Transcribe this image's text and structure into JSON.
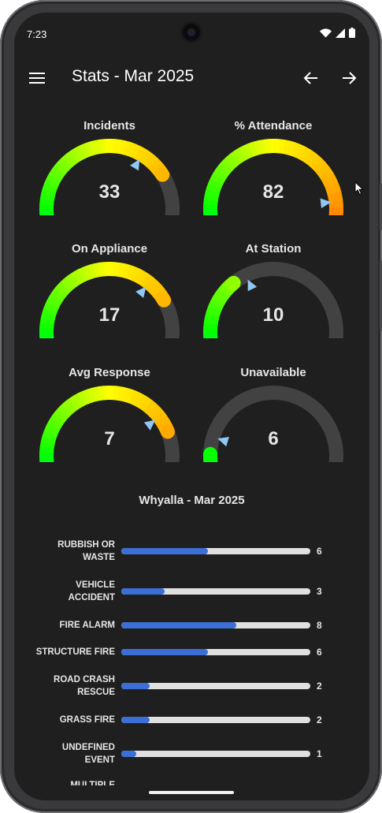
{
  "status": {
    "time": "7:23"
  },
  "header": {
    "title": "Stats - Mar 2025"
  },
  "gauges": [
    {
      "label": "Incidents",
      "value": "33",
      "level": 0.72,
      "marker": 0.62
    },
    {
      "label": "% Attendance",
      "value": "82",
      "level": 0.89,
      "marker": 0.82
    },
    {
      "label": "On Appliance",
      "value": "17",
      "level": 0.73,
      "marker": 0.65
    },
    {
      "label": "At Station",
      "value": "10",
      "level": 0.35,
      "marker": 0.4
    },
    {
      "label": "Avg Response",
      "value": "7",
      "level": 0.76,
      "marker": 0.7
    },
    {
      "label": "Unavailable",
      "value": "6",
      "level": 0.16,
      "marker": 0.22
    }
  ],
  "section": {
    "title": "Whyalla - Mar 2025"
  },
  "bars": [
    {
      "label": "RUBBISH OR WASTE",
      "value": "6",
      "fraction": 0.46
    },
    {
      "label": "VEHICLE ACCIDENT",
      "value": "3",
      "fraction": 0.23
    },
    {
      "label": "FIRE ALARM",
      "value": "8",
      "fraction": 0.61
    },
    {
      "label": "STRUCTURE FIRE",
      "value": "6",
      "fraction": 0.46
    },
    {
      "label": "ROAD CRASH RESCUE",
      "value": "2",
      "fraction": 0.15
    },
    {
      "label": "GRASS FIRE",
      "value": "2",
      "fraction": 0.15
    },
    {
      "label": "UNDEFINED EVENT",
      "value": "1",
      "fraction": 0.08
    }
  ],
  "cut_off_label": "MULTIPLE",
  "icons": {
    "menu": "menu-icon",
    "prev": "arrow-left-icon",
    "next": "arrow-right-icon",
    "wifi": "wifi-icon",
    "signal": "signal-icon",
    "battery": "battery-icon"
  },
  "colors": {
    "background": "#1f1f1f",
    "track": "#424242",
    "bar_fill": "#3b6fd6",
    "bar_track": "#e0e0e0",
    "marker": "#90c8f5"
  }
}
